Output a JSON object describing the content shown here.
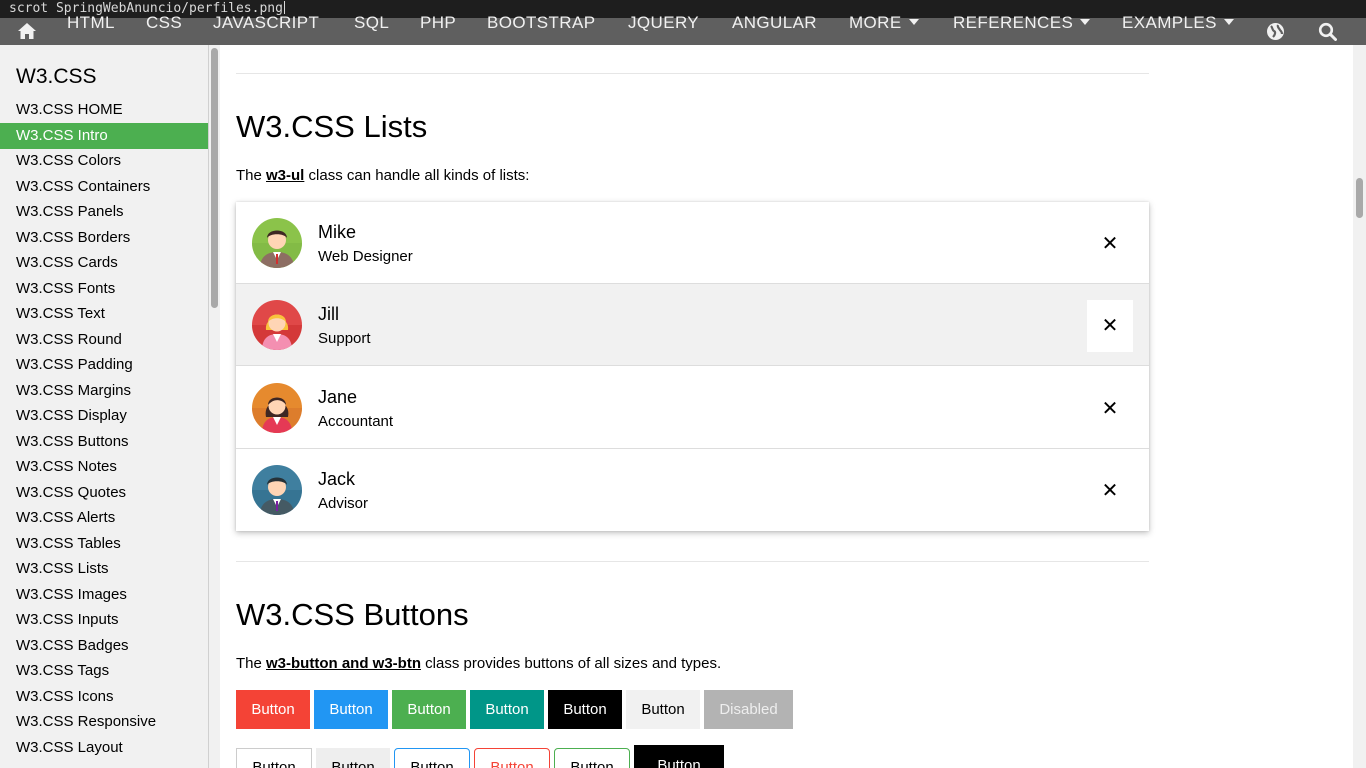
{
  "terminal": {
    "command": "scrot SpringWebAnuncio/perfiles.png"
  },
  "topnav": {
    "items": [
      "HTML",
      "CSS",
      "JAVASCRIPT",
      "SQL",
      "PHP",
      "BOOTSTRAP",
      "JQUERY",
      "ANGULAR",
      "MORE",
      "REFERENCES",
      "EXAMPLES"
    ],
    "icons": {
      "home": "home-icon",
      "globe": "globe-icon",
      "search": "search-icon"
    }
  },
  "sidebar": {
    "title": "W3.CSS",
    "items": [
      "W3.CSS HOME",
      "W3.CSS Intro",
      "W3.CSS Colors",
      "W3.CSS Containers",
      "W3.CSS Panels",
      "W3.CSS Borders",
      "W3.CSS Cards",
      "W3.CSS Fonts",
      "W3.CSS Text",
      "W3.CSS Round",
      "W3.CSS Padding",
      "W3.CSS Margins",
      "W3.CSS Display",
      "W3.CSS Buttons",
      "W3.CSS Notes",
      "W3.CSS Quotes",
      "W3.CSS Alerts",
      "W3.CSS Tables",
      "W3.CSS Lists",
      "W3.CSS Images",
      "W3.CSS Inputs",
      "W3.CSS Badges",
      "W3.CSS Tags",
      "W3.CSS Icons",
      "W3.CSS Responsive",
      "W3.CSS Layout"
    ],
    "active": "W3.CSS Intro",
    "active_color": "#4caf50"
  },
  "lists_section": {
    "heading": "W3.CSS Lists",
    "intro_pre": "The ",
    "intro_class": "w3-ul",
    "intro_post": " class can handle all kinds of lists:",
    "people": [
      {
        "name": "Mike",
        "role": "Web Designer",
        "avatar": "male-avatar-green"
      },
      {
        "name": "Jill",
        "role": "Support",
        "avatar": "female-avatar-red"
      },
      {
        "name": "Jane",
        "role": "Accountant",
        "avatar": "female-avatar-orange"
      },
      {
        "name": "Jack",
        "role": "Advisor",
        "avatar": "male-avatar-blue"
      }
    ],
    "close_glyph": "✕"
  },
  "buttons_section": {
    "heading": "W3.CSS Buttons",
    "intro_pre": "The ",
    "intro_class": "w3-button and w3-btn",
    "intro_post": " class provides buttons of all sizes and types.",
    "row1": [
      {
        "label": "Button",
        "bg": "#f44336",
        "fg": "#ffffff"
      },
      {
        "label": "Button",
        "bg": "#2196f3",
        "fg": "#ffffff"
      },
      {
        "label": "Button",
        "bg": "#4caf50",
        "fg": "#ffffff"
      },
      {
        "label": "Button",
        "bg": "#009688",
        "fg": "#ffffff"
      },
      {
        "label": "Button",
        "bg": "#000000",
        "fg": "#ffffff"
      },
      {
        "label": "Button",
        "bg": "#f1f1f1",
        "fg": "#000000"
      },
      {
        "label": "Disabled",
        "bg": "#b3b3b3",
        "fg": "#eeeeee"
      }
    ],
    "row2": [
      {
        "label": "Button",
        "border": "#cccccc",
        "fg": "#000000",
        "bg": "#ffffff"
      },
      {
        "label": "Button",
        "border": "#eeeeee",
        "fg": "#000000",
        "bg": "#eeeeee"
      },
      {
        "label": "Button",
        "border": "#2196f3",
        "fg": "#000000",
        "bg": "#ffffff"
      },
      {
        "label": "Button",
        "border": "#f44336",
        "fg": "#f44336",
        "bg": "#ffffff"
      },
      {
        "label": "Button",
        "border": "#4caf50",
        "fg": "#000000",
        "bg": "#ffffff"
      },
      {
        "label": "Button",
        "border": "#000000",
        "fg": "#ffffff",
        "bg": "#000000"
      }
    ]
  }
}
